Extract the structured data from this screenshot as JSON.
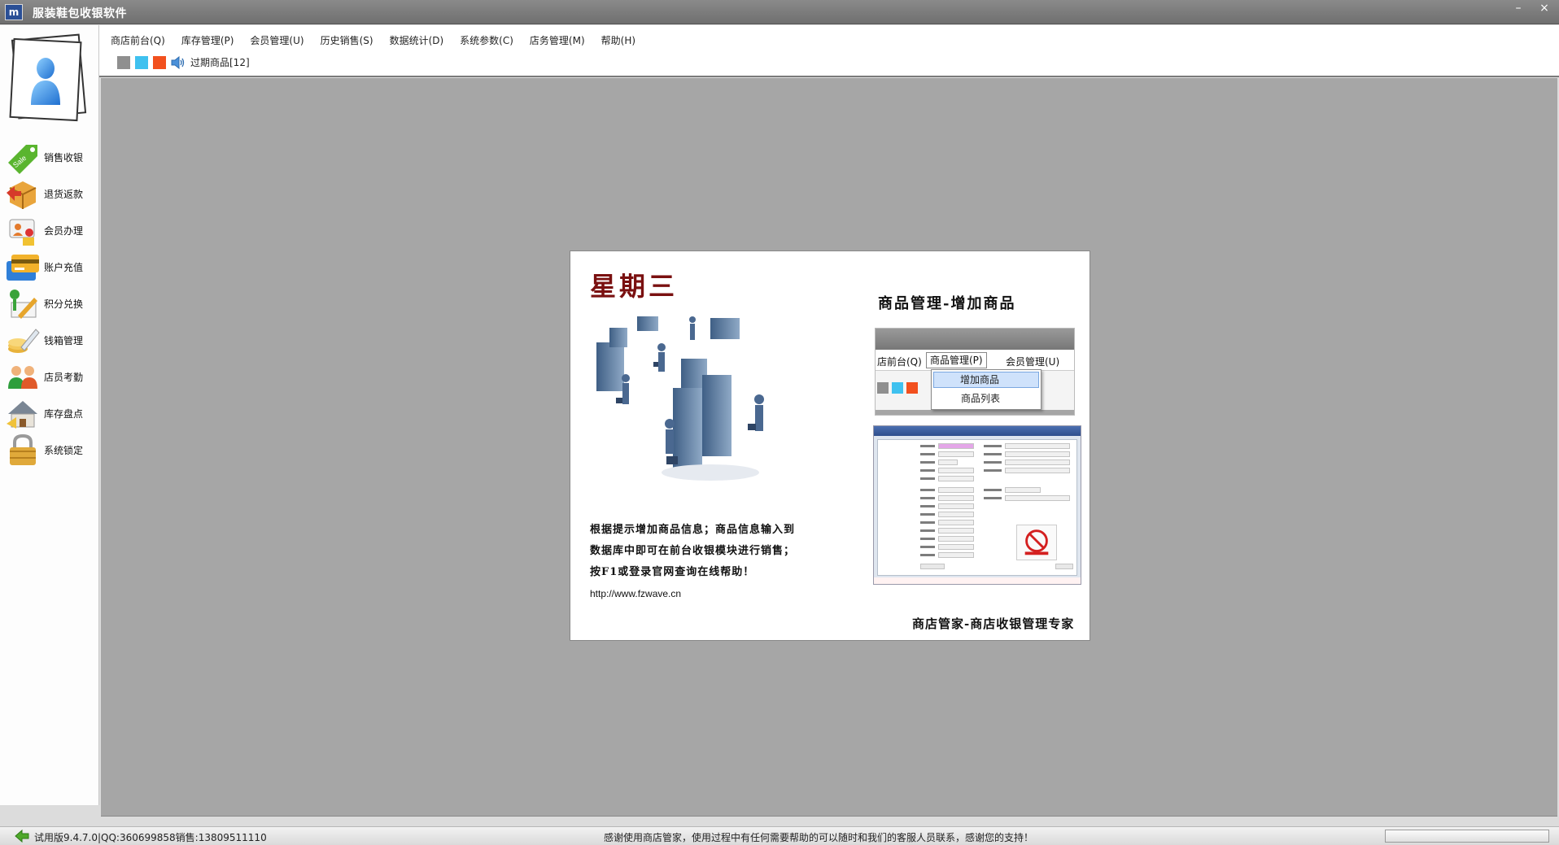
{
  "window": {
    "title": "服装鞋包收银软件",
    "icon": "app-logo-icon",
    "controls": {
      "minimize": "–",
      "close": "×"
    }
  },
  "sidebar": {
    "avatar_icon": "user-avatar-icon",
    "items": [
      {
        "label": "销售收银",
        "icon": "sale-tag-icon"
      },
      {
        "label": "退货返款",
        "icon": "return-box-icon"
      },
      {
        "label": "会员办理",
        "icon": "member-icon"
      },
      {
        "label": "账户充值",
        "icon": "card-recharge-icon"
      },
      {
        "label": "积分兑换",
        "icon": "points-exchange-icon"
      },
      {
        "label": "钱箱管理",
        "icon": "cashbox-icon"
      },
      {
        "label": "店员考勤",
        "icon": "staff-attendance-icon"
      },
      {
        "label": "库存盘点",
        "icon": "inventory-house-icon"
      },
      {
        "label": "系统锁定",
        "icon": "lock-icon"
      }
    ]
  },
  "menubar": {
    "items": [
      "商店前台(Q)",
      "库存管理(P)",
      "会员管理(U)",
      "历史销售(S)",
      "数据统计(D)",
      "系统参数(C)",
      "店务管理(M)",
      "帮助(H)"
    ]
  },
  "toolbar": {
    "swatches": [
      "#8f8f8f",
      "#3fc1ef",
      "#f2501e"
    ],
    "speaker_icon": "speaker-icon",
    "expired_label": "过期商品[12]"
  },
  "splash": {
    "weekday": "星期三",
    "heading": "商品管理-增加商品",
    "tips": [
      "根据提示增加商品信息；商品信息输入到",
      "数据库中即可在前台收银模块进行销售；",
      "按F1或登录官网查询在线帮助！"
    ],
    "url": "http://www.fzwave.cn",
    "tagline": "商店管家-商店收银管理专家",
    "mini_menu": {
      "bar": [
        "店前台(Q)",
        "商品管理(P)",
        "会员管理(U)"
      ],
      "dropdown": [
        "增加商品",
        "商品列表"
      ]
    }
  },
  "statusbar": {
    "left": "试用版9.4.7.0|QQ:360699858销售:13809511110",
    "center": "感谢使用商店管家，使用过程中有任何需要帮助的可以随时和我们的客服人员联系，感谢您的支持！"
  }
}
